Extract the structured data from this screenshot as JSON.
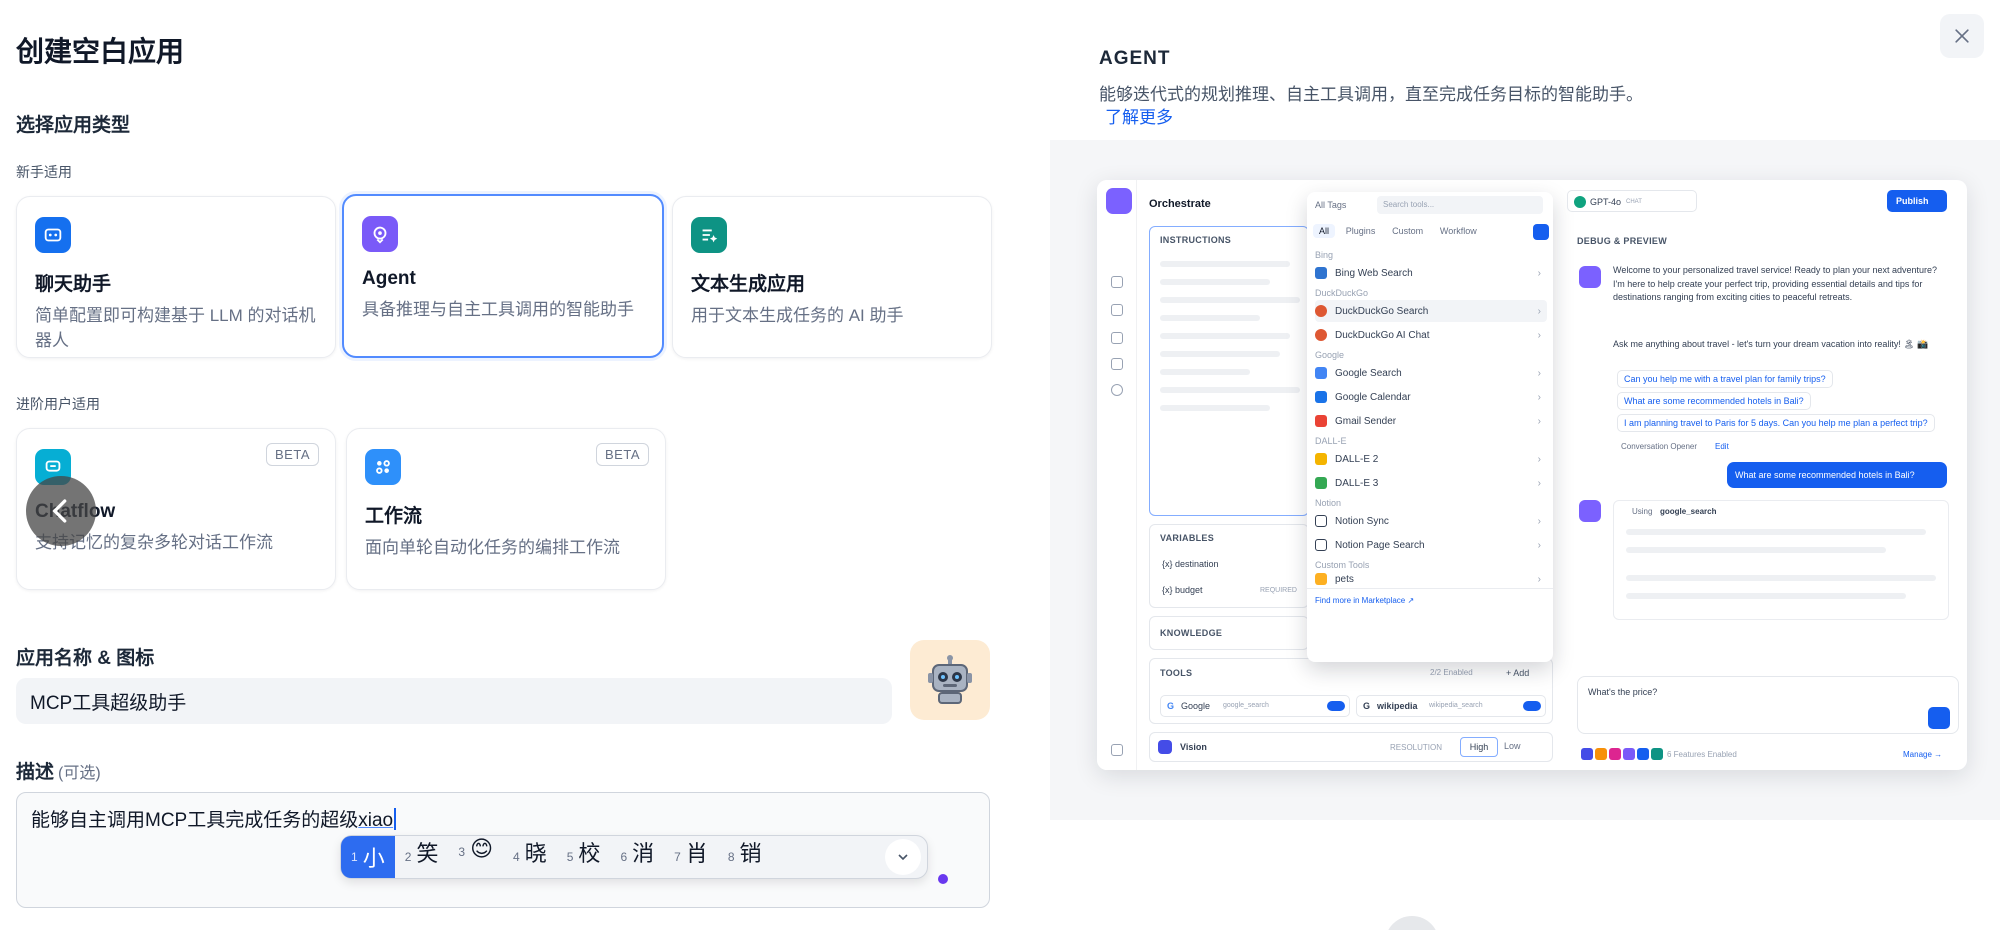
{
  "dialog": {
    "title": "创建空白应用",
    "select_type_title": "选择应用类型",
    "beginner_label": "新手适用",
    "advanced_label": "进阶用户适用",
    "app_types": [
      {
        "name": "聊天助手",
        "desc": "简单配置即可构建基于 LLM 的对话机器人",
        "icon": "chat-bot-icon",
        "color": "#1570ef"
      },
      {
        "name": "Agent",
        "desc": "具备推理与自主工具调用的智能助手",
        "icon": "agent-icon",
        "color": "#7a5af8",
        "selected": true
      },
      {
        "name": "文本生成应用",
        "desc": "用于文本生成任务的 AI 助手",
        "icon": "text-generation-icon",
        "color": "#0e9384"
      },
      {
        "name": "Chatflow",
        "desc": "支持记忆的复杂多轮对话工作流",
        "icon": "chatflow-icon",
        "color": "#06aed4",
        "badge": "BETA"
      },
      {
        "name": "工作流",
        "desc": "面向单轮自动化任务的编排工作流",
        "icon": "workflow-icon",
        "color": "#2e90fa",
        "badge": "BETA"
      }
    ],
    "name_icon_label": "应用名称 & 图标",
    "name_value": "MCP工具超级助手",
    "desc_label": "描述",
    "desc_optional": "(可选)",
    "desc_text": "能够自主调用MCP工具完成任务的超级",
    "desc_composing": "xiao",
    "ime_candidates": [
      {
        "n": "1",
        "text": "小"
      },
      {
        "n": "2",
        "text": "笑"
      },
      {
        "n": "3",
        "text": "😊"
      },
      {
        "n": "4",
        "text": "晓"
      },
      {
        "n": "5",
        "text": "校"
      },
      {
        "n": "6",
        "text": "消"
      },
      {
        "n": "7",
        "text": "肖"
      },
      {
        "n": "8",
        "text": "销"
      }
    ]
  },
  "preview": {
    "title": "AGENT",
    "description": "能够迭代式的规划推理、自主工具调用，直至完成任务目标的智能助手。",
    "learn_more": "了解更多",
    "shot": {
      "orchestrate": "Orchestrate",
      "instructions": "INSTRUCTIONS",
      "variables": "VARIABLES",
      "var_destination": "{x} destination",
      "var_budget": "{x} budget",
      "required": "REQUIRED",
      "knowledge": "KNOWLEDGE",
      "tools": "TOOLS",
      "tools_enabled": "2/2 Enabled",
      "add": "+ Add",
      "tool_google": "Google",
      "tool_google_sub": "google_search",
      "tool_wiki": "wikipedia",
      "tool_wiki_sub": "wikipedia_search",
      "vision": "Vision",
      "resolution": "RESOLUTION",
      "high": "High",
      "low": "Low",
      "all_tags": "All Tags",
      "search_tools": "Search tools...",
      "tabs": [
        "All",
        "Plugins",
        "Custom",
        "Workflow"
      ],
      "groups": {
        "bing": "Bing",
        "ddg": "DuckDuckGo",
        "google": "Google",
        "dalle": "DALL-E",
        "notion": "Notion",
        "custom": "Custom Tools"
      },
      "tools_list": {
        "bing_search": "Bing Web Search",
        "ddg_search": "DuckDuckGo Search",
        "ddg_chat": "DuckDuckGo AI Chat",
        "google_search": "Google Search",
        "google_calendar": "Google Calendar",
        "gmail": "Gmail Sender",
        "dalle2": "DALL-E 2",
        "dalle3": "DALL-E 3",
        "notion_sync": "Notion Sync",
        "notion_page": "Notion Page Search",
        "custom_item": "pets"
      },
      "find_more": "Find more in  Marketplace ↗",
      "model": "GPT-4o",
      "model_tag": "CHAT",
      "publish": "Publish",
      "debug": "DEBUG & PREVIEW",
      "welcome": "Welcome to your personalized travel service! Ready to plan your next adventure? I'm here to help create your perfect trip, providing essential details and tips for destinations ranging from exciting cities to peaceful retreats.",
      "ask": "Ask me anything about travel - let's turn your dream vacation into reality! 🏝 📸",
      "suggestions": [
        "Can you help me with a travel plan for family trips?",
        "What are some recommended hotels in Bali?",
        "I am planning travel to Paris for 5 days. Can you help me plan a perfect trip?"
      ],
      "opener": "Conversation Opener",
      "edit": "Edit",
      "user_msg": "What are some recommended hotels in Bali?",
      "using": "Using",
      "using_tool": "google_search",
      "input": "What's the price?",
      "features": "6 Features Enabled",
      "manage": "Manage →"
    }
  }
}
